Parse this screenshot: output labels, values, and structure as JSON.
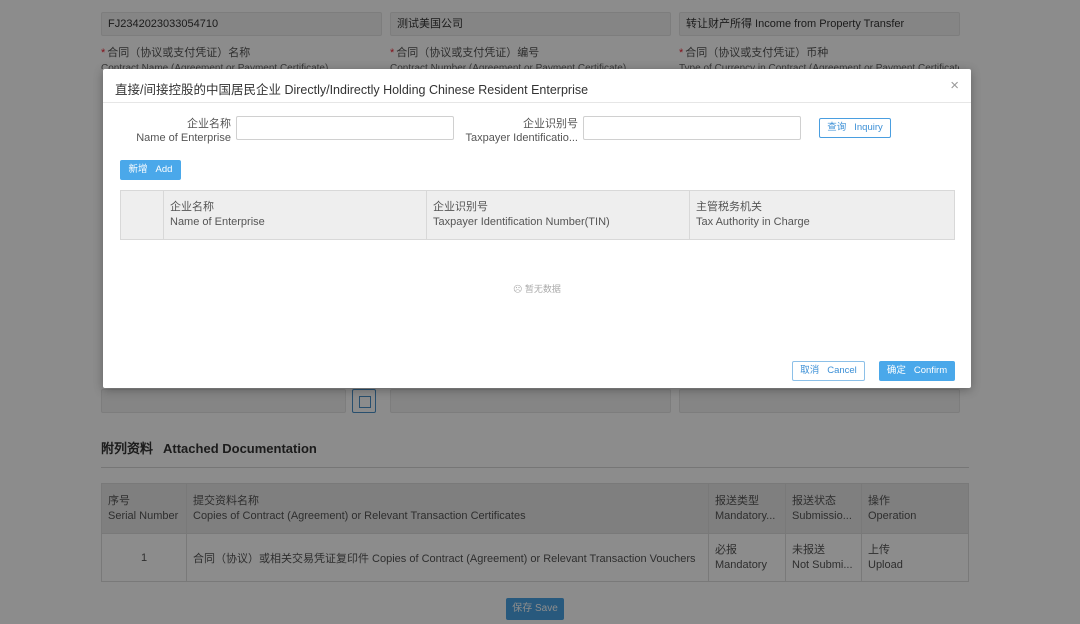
{
  "form": {
    "row1_values": [
      "FJ2342023033054710",
      "测试美国公司",
      "转让财产所得 Income from Property Transfer"
    ],
    "field1": {
      "label_cn": "合同（协议或支付凭证）名称",
      "label_en": "Contract Name (Agreement or Payment Certificate)"
    },
    "field2": {
      "label_cn": "合同（协议或支付凭证）编号",
      "label_en": "Contract Number (Agreement or Payment Certificate)"
    },
    "field3": {
      "label_cn": "合同（协议或支付凭证）币种",
      "label_en": "Type of Currency in Contract (Agreement or Payment Certificate)"
    }
  },
  "docs": {
    "title_cn": "附列资料",
    "title_en": "Attached Documentation",
    "headers": [
      {
        "cn": "序号",
        "en": "Serial Number"
      },
      {
        "cn": "提交资料名称",
        "en": "Copies of Contract (Agreement) or Relevant Transaction Certificates"
      },
      {
        "cn": "报送类型",
        "en": "Mandatory..."
      },
      {
        "cn": "报送状态",
        "en": "Submissio..."
      },
      {
        "cn": "操作",
        "en": "Operation"
      }
    ],
    "rows": [
      {
        "serial": "1",
        "name": "合同（协议）或相关交易凭证复印件 Copies of Contract (Agreement) or Relevant Transaction Vouchers",
        "type_cn": "必报",
        "type_en": "Mandatory",
        "status_cn": "未报送",
        "status_en": "Not Submi...",
        "op_cn": "上传",
        "op_en": "Upload"
      }
    ]
  },
  "save_label": "保存 Save",
  "modal": {
    "title": "直接/间接控股的中国居民企业   Directly/Indirectly Holding Chinese Resident Enterprise",
    "close": "×",
    "enterprise_label_cn": "企业名称",
    "enterprise_label_en": "Name of Enterprise",
    "enterprise_value": "",
    "tin_label_cn": "企业识别号",
    "tin_label_en": "Taxpayer Identificatio...",
    "tin_value": "",
    "inquiry_cn": "查询",
    "inquiry_en": "Inquiry",
    "add_cn": "新增",
    "add_en": "Add",
    "table_headers": [
      {
        "cn": "企业名称",
        "en": "Name of Enterprise"
      },
      {
        "cn": "企业识别号",
        "en": "Taxpayer Identification Number(TIN)"
      },
      {
        "cn": "主管税务机关",
        "en": "Tax Authority in Charge"
      }
    ],
    "empty_text": "☹ 暂无数据",
    "cancel_cn": "取消",
    "cancel_en": "Cancel",
    "confirm_cn": "确定",
    "confirm_en": "Confirm"
  }
}
